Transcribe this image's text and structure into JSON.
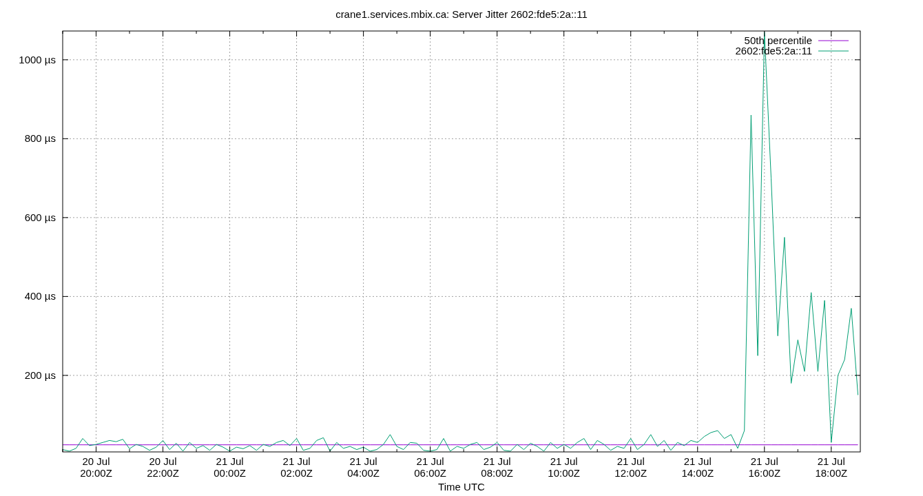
{
  "chart_data": {
    "type": "line",
    "title": "crane1.services.mbix.ca: Server Jitter 2602:fde5:2a::11",
    "xlabel": "Time UTC",
    "categories": [
      null,
      null,
      null,
      null,
      null,
      "20 Jul 20:00Z",
      null,
      null,
      null,
      null,
      null,
      null,
      null,
      null,
      null,
      "20 Jul 22:00Z",
      null,
      null,
      null,
      null,
      null,
      null,
      null,
      null,
      null,
      "21 Jul 00:00Z",
      null,
      null,
      null,
      null,
      null,
      null,
      null,
      null,
      null,
      "21 Jul 02:00Z",
      null,
      null,
      null,
      null,
      null,
      null,
      null,
      null,
      null,
      "21 Jul 04:00Z",
      null,
      null,
      null,
      null,
      null,
      null,
      null,
      null,
      null,
      "21 Jul 06:00Z",
      null,
      null,
      null,
      null,
      null,
      null,
      null,
      null,
      null,
      "21 Jul 08:00Z",
      null,
      null,
      null,
      null,
      null,
      null,
      null,
      null,
      null,
      "21 Jul 10:00Z",
      null,
      null,
      null,
      null,
      null,
      null,
      null,
      null,
      null,
      "21 Jul 12:00Z",
      null,
      null,
      null,
      null,
      null,
      null,
      null,
      null,
      null,
      "21 Jul 14:00Z",
      null,
      null,
      null,
      null,
      null,
      null,
      null,
      null,
      null,
      "21 Jul 16:00Z",
      null,
      null,
      null,
      null,
      null,
      null,
      null,
      null,
      null,
      "21 Jul 18:00Z",
      null,
      null,
      null,
      null
    ],
    "series": [
      {
        "name": "50th percentile",
        "color": "#9400d3",
        "values": [
          24,
          24,
          24,
          24,
          24,
          24,
          24,
          24,
          24,
          24,
          24,
          24,
          24,
          24,
          24,
          24,
          24,
          24,
          24,
          24,
          24,
          24,
          24,
          24,
          24,
          24,
          24,
          24,
          24,
          24,
          24,
          24,
          24,
          24,
          24,
          24,
          24,
          24,
          24,
          24,
          24,
          24,
          24,
          24,
          24,
          24,
          24,
          24,
          24,
          24,
          24,
          24,
          24,
          24,
          24,
          24,
          24,
          24,
          24,
          24,
          24,
          24,
          24,
          24,
          24,
          24,
          24,
          24,
          24,
          24,
          24,
          24,
          24,
          24,
          24,
          24,
          24,
          24,
          24,
          24,
          24,
          24,
          24,
          24,
          24,
          24,
          24,
          24,
          24,
          24,
          24,
          24,
          24,
          24,
          24,
          24,
          24,
          24,
          24,
          24,
          24,
          24,
          24,
          24,
          24,
          24,
          24,
          24,
          24,
          24,
          24,
          24,
          24,
          24,
          24,
          24,
          24,
          24,
          24,
          24
        ]
      },
      {
        "name": "2602:fde5:2a::11",
        "color": "#009e73",
        "values": [
          12,
          8,
          15,
          40,
          22,
          25,
          30,
          35,
          32,
          38,
          14,
          25,
          20,
          10,
          18,
          35,
          12,
          28,
          8,
          30,
          15,
          22,
          10,
          25,
          18,
          8,
          18,
          14,
          22,
          10,
          25,
          20,
          30,
          35,
          22,
          40,
          10,
          15,
          35,
          42,
          8,
          30,
          15,
          20,
          12,
          18,
          8,
          12,
          25,
          50,
          20,
          12,
          30,
          28,
          10,
          8,
          12,
          40,
          8,
          20,
          15,
          25,
          30,
          12,
          18,
          30,
          10,
          8,
          25,
          12,
          28,
          20,
          8,
          30,
          15,
          25,
          15,
          30,
          40,
          12,
          35,
          25,
          10,
          20,
          15,
          40,
          12,
          25,
          50,
          20,
          35,
          10,
          30,
          22,
          35,
          30,
          45,
          55,
          60,
          40,
          50,
          15,
          60,
          860,
          250,
          1070,
          700,
          300,
          550,
          180,
          290,
          210,
          410,
          210,
          390,
          30,
          200,
          240,
          370,
          150
        ]
      }
    ],
    "ylim": [
      6,
      1073
    ],
    "grid": true,
    "legend": "top right",
    "yticks": [
      {
        "value": 200,
        "label": "200 µs"
      },
      {
        "value": 400,
        "label": "400 µs"
      },
      {
        "value": 600,
        "label": "600 µs"
      },
      {
        "value": 800,
        "label": "800 µs"
      },
      {
        "value": 1000,
        "label": "1000 µs"
      }
    ]
  }
}
